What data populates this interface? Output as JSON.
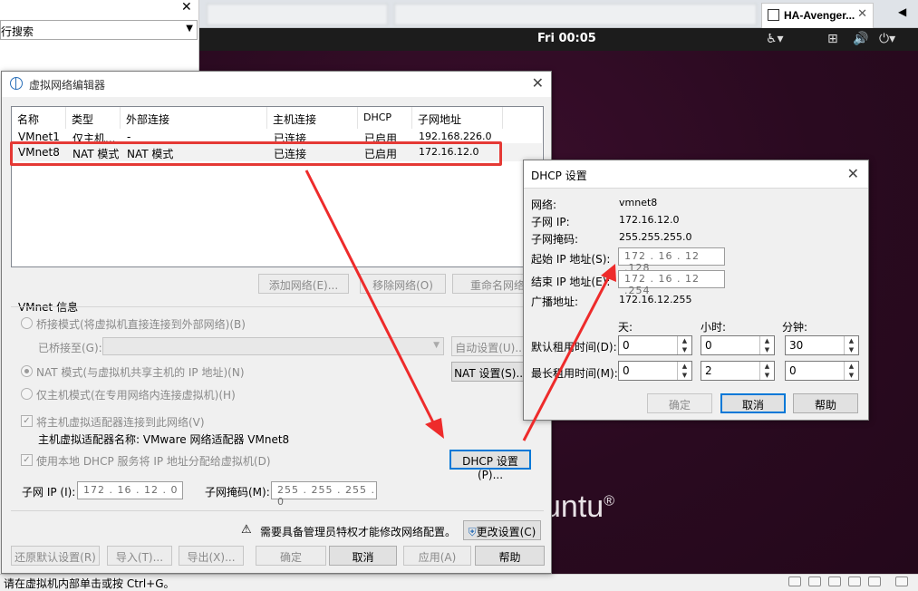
{
  "host": {
    "library_search_text": "行搜索",
    "active_tab_title": "HA-Avenger...",
    "clock": "Fri 00:05",
    "ubuntu_logo_text": "untu",
    "status_text": "请在虚拟机内部单击或按 Ctrl+G。"
  },
  "vne": {
    "title": "虚拟网络编辑器",
    "columns": [
      "名称",
      "类型",
      "外部连接",
      "主机连接",
      "DHCP",
      "子网地址"
    ],
    "rows": [
      [
        "VMnet1",
        "仅主机...",
        "-",
        "已连接",
        "已启用",
        "192.168.226.0"
      ],
      [
        "VMnet8",
        "NAT 模式",
        "NAT 模式",
        "已连接",
        "已启用",
        "172.16.12.0"
      ]
    ],
    "table_buttons": {
      "add": "添加网络(E)...",
      "remove": "移除网络(O)",
      "rename": "重命名网络"
    },
    "info_group": "VMnet 信息",
    "bridged_label": "桥接模式(将虚拟机直接连接到外部网络)(B)",
    "bridged_to_label": "已桥接至(G):",
    "auto_settings": "自动设置(U)...",
    "nat_label": "NAT 模式(与虚拟机共享主机的 IP 地址)(N)",
    "nat_settings": "NAT 设置(S)...",
    "hostonly_label": "仅主机模式(在专用网络内连接虚拟机)(H)",
    "connect_adapter_label": "将主机虚拟适配器连接到此网络(V)",
    "adapter_name_label": "主机虚拟适配器名称: VMware 网络适配器 VMnet8",
    "dhcp_service_label": "使用本地 DHCP 服务将 IP 地址分配给虚拟机(D)",
    "dhcp_settings": "DHCP 设置(P)...",
    "subnet_ip_label": "子网 IP (I):",
    "subnet_ip": "172 . 16 . 12 . 0",
    "subnet_mask_label": "子网掩码(M):",
    "subnet_mask": "255 . 255 . 255 . 0",
    "admin_note": "需要具备管理员特权才能修改网络配置。",
    "change_settings": "更改设置(C)",
    "footer": {
      "restore": "还原默认设置(R)",
      "import": "导入(T)...",
      "export": "导出(X)...",
      "ok": "确定",
      "cancel": "取消",
      "apply": "应用(A)",
      "help": "帮助"
    }
  },
  "dhcp": {
    "title": "DHCP 设置",
    "network_label": "网络:",
    "network": "vmnet8",
    "subnet_ip_label": "子网 IP:",
    "subnet_ip": "172.16.12.0",
    "subnet_mask_label": "子网掩码:",
    "subnet_mask": "255.255.255.0",
    "start_ip_label": "起始 IP 地址(S):",
    "start_ip": "172 . 16 . 12 .128",
    "end_ip_label": "结束 IP 地址(E):",
    "end_ip": "172 . 16 . 12 .254",
    "broadcast_label": "广播地址:",
    "broadcast": "172.16.12.255",
    "days_label": "天:",
    "hours_label": "小时:",
    "minutes_label": "分钟:",
    "default_lease_label": "默认租用时间(D):",
    "default_lease": [
      "0",
      "0",
      "30"
    ],
    "max_lease_label": "最长租用时间(M):",
    "max_lease": [
      "0",
      "2",
      "0"
    ],
    "ok": "确定",
    "cancel": "取消",
    "help": "帮助"
  },
  "colors": {
    "highlight": "#e53935",
    "focus": "#0078d7"
  }
}
